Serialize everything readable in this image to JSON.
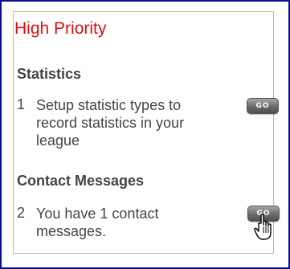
{
  "panel": {
    "title": "High Priority",
    "sections": [
      {
        "heading": "Statistics",
        "item_number": "1",
        "item_text": "Setup statistic types to record statistics in your league",
        "button_label": "GO"
      },
      {
        "heading": "Contact Messages",
        "item_number": "2",
        "item_text": "You have 1 contact messages.",
        "button_label": "GO"
      }
    ]
  },
  "colors": {
    "frame_border": "#0b0b9a",
    "title": "#e01010",
    "body_text": "#444444"
  },
  "icons": {
    "cursor": "hand-pointer-icon"
  }
}
